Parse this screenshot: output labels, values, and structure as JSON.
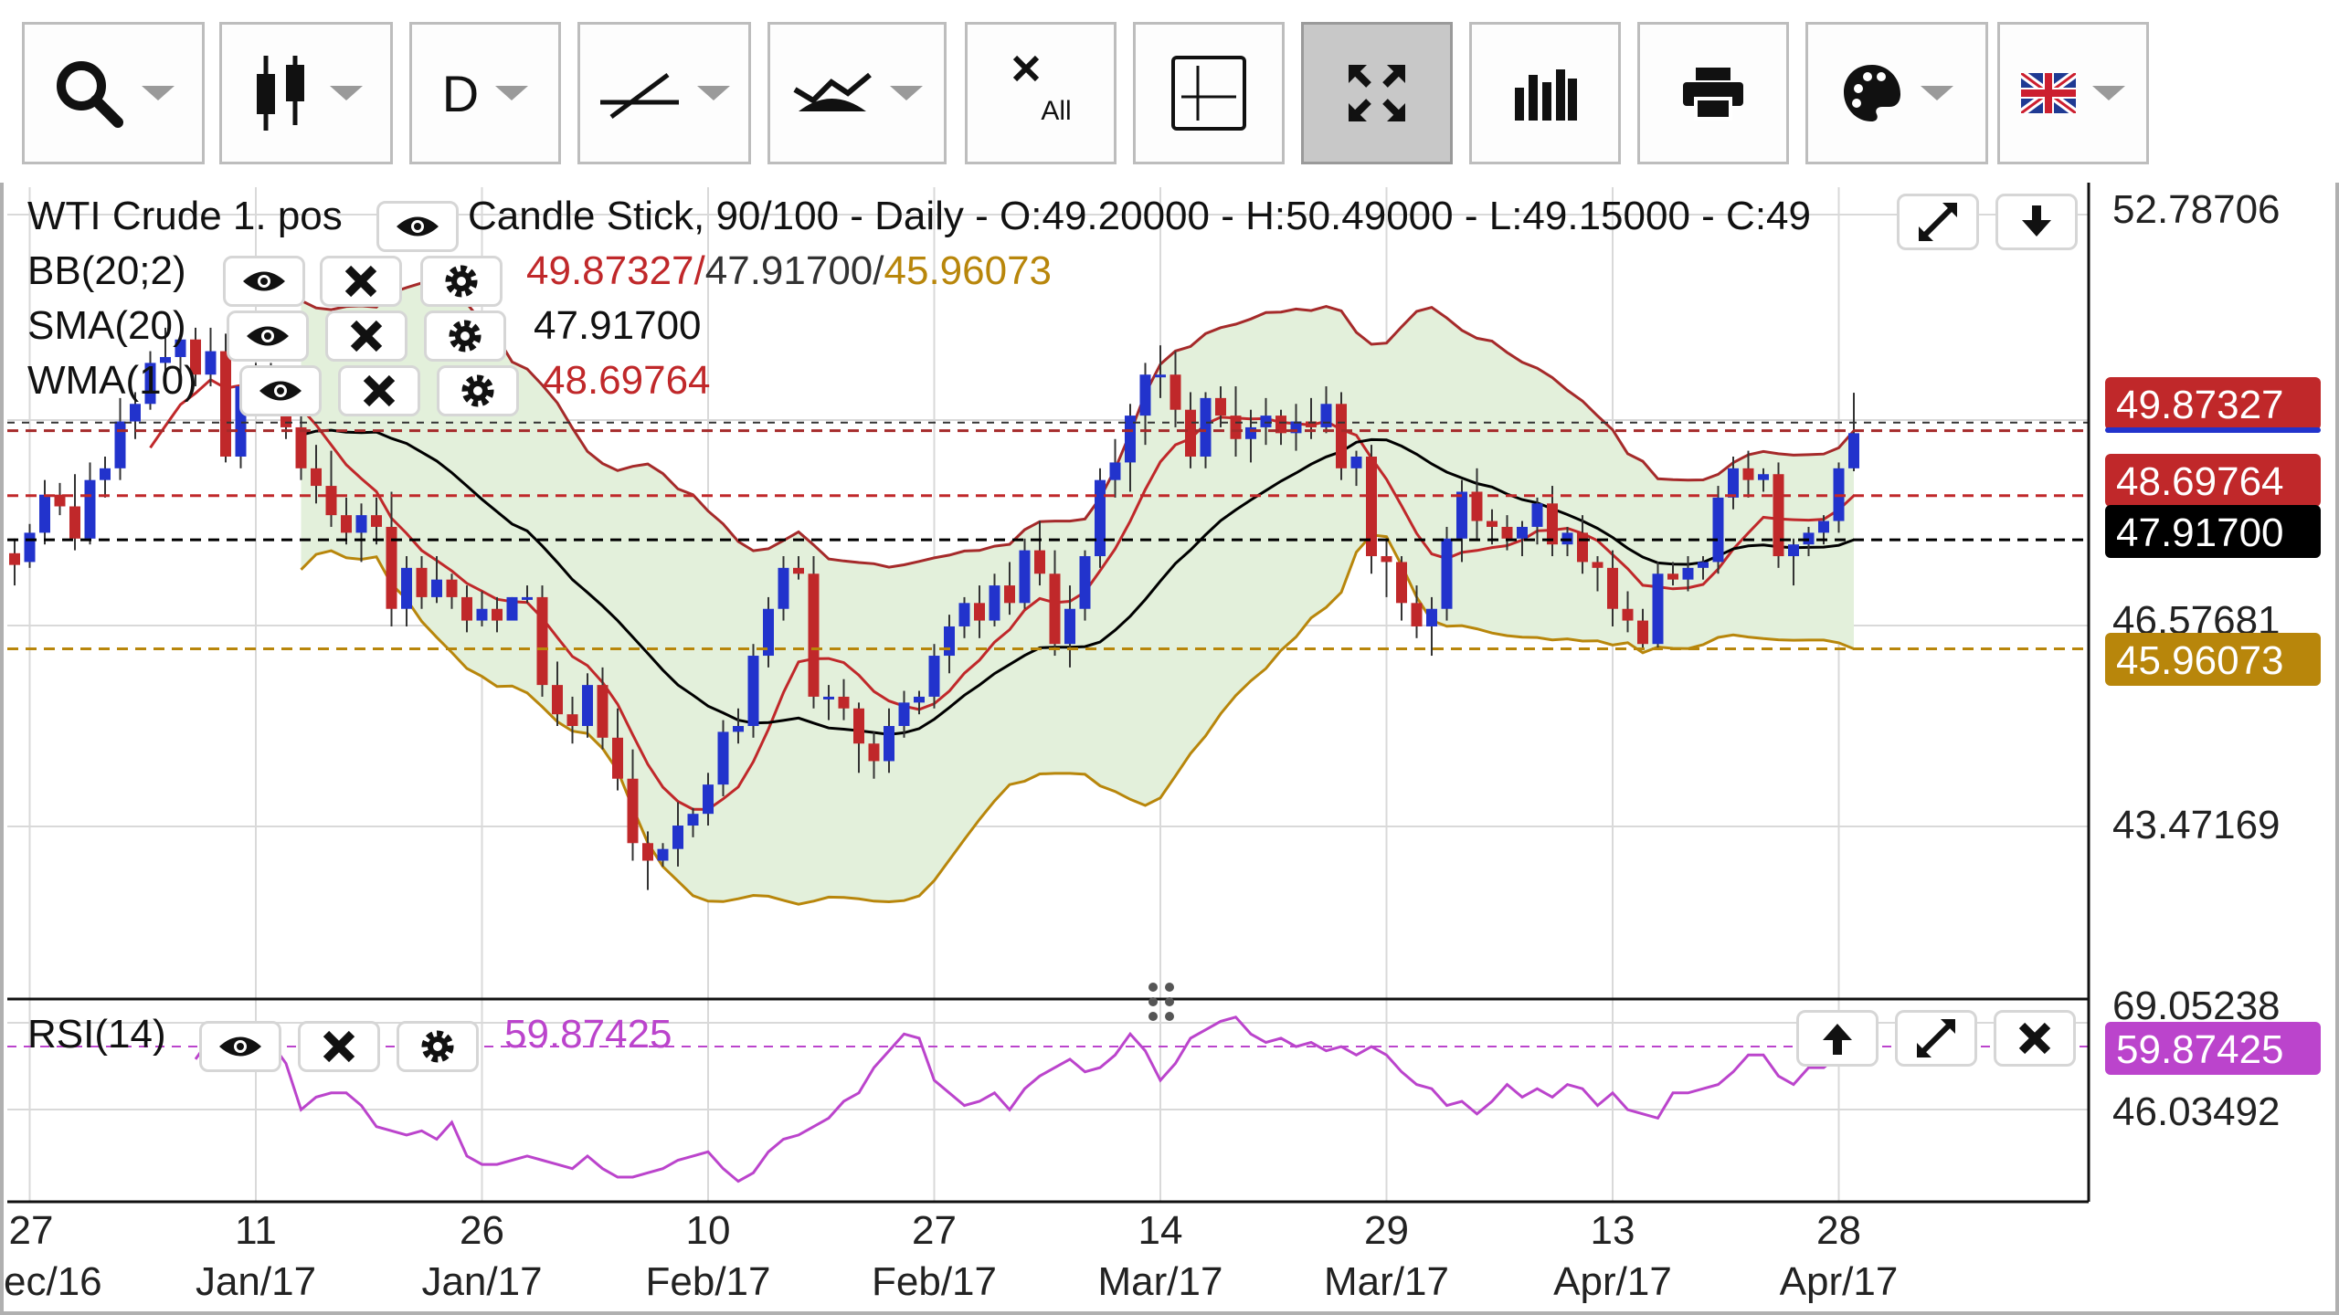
{
  "toolbar": {
    "period_label": "D",
    "clear_label": "All",
    "colors": {
      "border": "#bdbdbd",
      "active": "#c8c8c8"
    }
  },
  "header": {
    "instrument": "WTI Crude 1. pos",
    "description": "Candle Stick, 90/100 - Daily - O:49.20000 - H:50.49000 - L:49.15000 - C:49"
  },
  "indicators": {
    "bb": {
      "label": "BB(20;2)",
      "value_upper": "49.87327/",
      "value_mid": "47.91700/",
      "value_lower": "45.96073"
    },
    "sma": {
      "label": "SMA(20)",
      "value": "47.91700"
    },
    "wma": {
      "label": "WMA(10)",
      "value": "48.69764"
    },
    "rsi": {
      "label": "RSI(14)",
      "value": "59.87425"
    }
  },
  "price_axis": {
    "ticks": [
      "52.78706",
      "46.57681",
      "43.47169"
    ],
    "badges": {
      "upper": "49.87327",
      "wma": "48.69764",
      "sma": "47.91700",
      "lower": "45.96073"
    }
  },
  "rsi_axis": {
    "ticks": [
      "69.05238",
      "46.03492"
    ],
    "badge": "59.87425"
  },
  "x_axis": {
    "ticks": [
      {
        "day": "27",
        "month": "ec/16"
      },
      {
        "day": "11",
        "month": "Jan/17"
      },
      {
        "day": "26",
        "month": "Jan/17"
      },
      {
        "day": "10",
        "month": "Feb/17"
      },
      {
        "day": "27",
        "month": "Feb/17"
      },
      {
        "day": "14",
        "month": "Mar/17"
      },
      {
        "day": "29",
        "month": "Mar/17"
      },
      {
        "day": "13",
        "month": "Apr/17"
      },
      {
        "day": "28",
        "month": "Apr/17"
      }
    ]
  },
  "colors": {
    "bull": "#2233cc",
    "bear": "#c0282a",
    "bb_band": "#a52a2a",
    "bb_lower": "#b8860b",
    "sma": "#000000",
    "wma": "#c0282a",
    "rsi": "#bb44cc",
    "fill": "#e3f0db",
    "grid": "#d9d9d9"
  },
  "chart_data": {
    "type": "candlestick",
    "title": "WTI Crude 1. pos",
    "price_range": [
      40.2,
      54.0
    ],
    "rsi_range": [
      25,
      71
    ],
    "candles": [
      [
        47.75,
        48.0,
        47.2,
        47.55
      ],
      [
        47.6,
        48.25,
        47.5,
        48.1
      ],
      [
        48.1,
        49.0,
        47.9,
        48.75
      ],
      [
        48.75,
        48.95,
        48.4,
        48.55
      ],
      [
        48.55,
        49.1,
        47.8,
        48.0
      ],
      [
        48.0,
        49.3,
        47.9,
        49.0
      ],
      [
        49.0,
        49.4,
        48.7,
        49.2
      ],
      [
        49.2,
        50.4,
        49.0,
        50.0
      ],
      [
        50.0,
        50.5,
        49.7,
        50.3
      ],
      [
        50.3,
        51.2,
        50.2,
        51.0
      ],
      [
        51.0,
        51.6,
        50.7,
        51.1
      ],
      [
        51.1,
        51.5,
        50.8,
        51.4
      ],
      [
        51.4,
        51.6,
        50.6,
        50.8
      ],
      [
        50.8,
        51.6,
        50.6,
        51.2
      ],
      [
        51.2,
        51.5,
        49.3,
        49.4
      ],
      [
        49.4,
        50.8,
        49.2,
        50.6
      ],
      [
        50.6,
        51.0,
        50.3,
        50.6
      ],
      [
        50.6,
        51.0,
        50.4,
        50.7
      ],
      [
        50.7,
        50.9,
        49.7,
        49.9
      ],
      [
        49.9,
        50.4,
        49.0,
        49.2
      ],
      [
        49.2,
        49.6,
        48.6,
        48.9
      ],
      [
        48.9,
        49.5,
        48.2,
        48.4
      ],
      [
        48.4,
        48.7,
        47.9,
        48.1
      ],
      [
        48.1,
        48.6,
        47.6,
        48.4
      ],
      [
        48.4,
        48.7,
        47.9,
        48.2
      ],
      [
        48.2,
        48.8,
        46.5,
        46.8
      ],
      [
        46.8,
        47.7,
        46.5,
        47.5
      ],
      [
        47.5,
        47.7,
        46.8,
        47.0
      ],
      [
        47.0,
        47.7,
        46.9,
        47.3
      ],
      [
        47.3,
        47.4,
        46.8,
        47.0
      ],
      [
        47.0,
        47.2,
        46.4,
        46.6
      ],
      [
        46.6,
        47.1,
        46.5,
        46.8
      ],
      [
        46.8,
        47.0,
        46.4,
        46.6
      ],
      [
        46.6,
        47.0,
        46.8,
        47.0
      ],
      [
        47.0,
        47.2,
        46.9,
        47.0
      ],
      [
        47.0,
        47.2,
        45.3,
        45.5
      ],
      [
        45.5,
        45.9,
        44.8,
        45.0
      ],
      [
        45.0,
        45.3,
        44.5,
        44.8
      ],
      [
        44.8,
        45.7,
        44.6,
        45.5
      ],
      [
        45.5,
        45.8,
        44.4,
        44.6
      ],
      [
        44.6,
        45.1,
        43.7,
        43.9
      ],
      [
        43.9,
        44.4,
        42.5,
        42.8
      ],
      [
        42.8,
        43.0,
        42.0,
        42.5
      ],
      [
        42.5,
        42.8,
        42.4,
        42.7
      ],
      [
        42.7,
        43.5,
        42.4,
        43.1
      ],
      [
        43.1,
        43.4,
        42.9,
        43.3
      ],
      [
        43.3,
        44.0,
        43.1,
        43.8
      ],
      [
        43.8,
        44.9,
        43.6,
        44.7
      ],
      [
        44.7,
        45.1,
        44.5,
        44.8
      ],
      [
        44.8,
        46.2,
        44.6,
        46.0
      ],
      [
        46.0,
        47.0,
        45.8,
        46.8
      ],
      [
        46.8,
        47.7,
        46.6,
        47.5
      ],
      [
        47.5,
        47.7,
        47.3,
        47.4
      ],
      [
        47.4,
        47.7,
        45.1,
        45.3
      ],
      [
        45.3,
        45.5,
        44.9,
        45.3
      ],
      [
        45.3,
        45.6,
        44.9,
        45.1
      ],
      [
        45.1,
        45.2,
        44.0,
        44.5
      ],
      [
        44.5,
        44.7,
        43.9,
        44.2
      ],
      [
        44.2,
        45.1,
        44.0,
        44.8
      ],
      [
        44.8,
        45.4,
        44.6,
        45.2
      ],
      [
        45.2,
        45.4,
        45.0,
        45.3
      ],
      [
        45.3,
        46.2,
        45.1,
        46.0
      ],
      [
        46.0,
        46.7,
        45.7,
        46.5
      ],
      [
        46.5,
        47.0,
        46.3,
        46.9
      ],
      [
        46.9,
        47.2,
        46.3,
        46.6
      ],
      [
        46.6,
        47.4,
        46.5,
        47.2
      ],
      [
        47.2,
        47.6,
        46.7,
        46.9
      ],
      [
        46.9,
        48.0,
        46.8,
        47.8
      ],
      [
        47.8,
        48.3,
        47.2,
        47.4
      ],
      [
        47.4,
        47.8,
        46.0,
        46.2
      ],
      [
        46.2,
        47.2,
        45.8,
        46.8
      ],
      [
        46.8,
        47.8,
        46.6,
        47.7
      ],
      [
        47.7,
        49.2,
        47.5,
        49.0
      ],
      [
        49.0,
        49.7,
        48.7,
        49.3
      ],
      [
        49.3,
        50.3,
        48.8,
        50.1
      ],
      [
        50.1,
        51.0,
        49.6,
        50.8
      ],
      [
        50.8,
        51.3,
        50.4,
        50.8
      ],
      [
        50.8,
        51.2,
        49.9,
        50.2
      ],
      [
        50.2,
        50.5,
        49.2,
        49.4
      ],
      [
        49.4,
        50.5,
        49.2,
        50.4
      ],
      [
        50.4,
        50.6,
        49.9,
        50.1
      ],
      [
        50.1,
        50.6,
        49.4,
        49.7
      ],
      [
        49.7,
        50.2,
        49.3,
        49.9
      ],
      [
        49.9,
        50.4,
        49.6,
        50.1
      ],
      [
        50.1,
        50.2,
        49.6,
        49.8
      ],
      [
        49.8,
        50.3,
        49.5,
        50.0
      ],
      [
        50.0,
        50.4,
        49.7,
        49.9
      ],
      [
        49.9,
        50.6,
        49.8,
        50.3
      ],
      [
        50.3,
        50.5,
        49.0,
        49.2
      ],
      [
        49.2,
        49.5,
        48.9,
        49.4
      ],
      [
        49.4,
        49.6,
        47.4,
        47.7
      ],
      [
        47.7,
        48.0,
        47.0,
        47.6
      ],
      [
        47.6,
        47.7,
        46.6,
        46.9
      ],
      [
        46.9,
        47.2,
        46.3,
        46.5
      ],
      [
        46.5,
        47.0,
        46.0,
        46.8
      ],
      [
        46.8,
        48.2,
        46.6,
        48.0
      ],
      [
        48.0,
        49.0,
        47.6,
        48.8
      ],
      [
        48.8,
        49.2,
        48.0,
        48.3
      ],
      [
        48.3,
        48.5,
        47.9,
        48.2
      ],
      [
        48.2,
        48.4,
        47.8,
        48.0
      ],
      [
        48.0,
        48.3,
        47.7,
        48.2
      ],
      [
        48.2,
        48.7,
        47.9,
        48.6
      ],
      [
        48.6,
        48.9,
        47.7,
        47.9
      ],
      [
        47.9,
        48.2,
        47.7,
        48.1
      ],
      [
        48.1,
        48.4,
        47.4,
        47.6
      ],
      [
        47.6,
        47.7,
        47.1,
        47.5
      ],
      [
        47.5,
        47.8,
        46.5,
        46.8
      ],
      [
        46.8,
        47.1,
        46.4,
        46.6
      ],
      [
        46.6,
        46.8,
        46.1,
        46.2
      ],
      [
        46.2,
        47.6,
        46.1,
        47.4
      ],
      [
        47.4,
        47.6,
        47.2,
        47.3
      ],
      [
        47.3,
        47.7,
        47.1,
        47.5
      ],
      [
        47.5,
        47.7,
        47.3,
        47.6
      ],
      [
        47.6,
        48.9,
        47.4,
        48.7
      ],
      [
        48.7,
        49.4,
        48.5,
        49.2
      ],
      [
        49.2,
        49.5,
        48.7,
        49.0
      ],
      [
        49.0,
        49.2,
        48.8,
        49.1
      ],
      [
        49.1,
        49.3,
        47.5,
        47.7
      ],
      [
        47.7,
        48.0,
        47.2,
        47.9
      ],
      [
        47.9,
        48.2,
        47.7,
        48.1
      ],
      [
        48.1,
        48.4,
        47.9,
        48.3
      ],
      [
        48.3,
        49.3,
        48.1,
        49.2
      ],
      [
        49.2,
        50.49,
        49.15,
        49.8
      ]
    ],
    "rsi_start": 12,
    "rsi": [
      58.0,
      63.0,
      66.0,
      63.0,
      64.0,
      62.0,
      57.0,
      46.0,
      49.0,
      50.0,
      50.0,
      47.0,
      42.0,
      41.0,
      40.0,
      41.0,
      39.0,
      43.0,
      35.0,
      33.0,
      33.0,
      34.0,
      35.0,
      34.0,
      33.0,
      32.0,
      35.0,
      32.0,
      30.0,
      30.0,
      31.0,
      32.0,
      34.0,
      35.0,
      36.0,
      32.0,
      29.0,
      31.0,
      36.0,
      39.0,
      40.0,
      42.0,
      44.0,
      48.0,
      50.0,
      56.0,
      60.0,
      64.0,
      63.0,
      53.0,
      50.0,
      47.0,
      48.0,
      50.0,
      46.0,
      51.0,
      54.0,
      56.0,
      58.0,
      55.0,
      56.0,
      59.0,
      64.0,
      60.0,
      53.0,
      57.0,
      63.0,
      65.0,
      67.0,
      68.0,
      64.0,
      62.0,
      63.0,
      61.0,
      62.0,
      60.0,
      61.0,
      59.0,
      61.0,
      59.0,
      55.0,
      52.0,
      51.0,
      47.0,
      48.0,
      45.0,
      48.0,
      52.0,
      49.0,
      51.0,
      49.0,
      52.0,
      51.0,
      47.0,
      50.0,
      46.0,
      45.0,
      44.0,
      50.0,
      50.0,
      51.0,
      52.0,
      55.0,
      59.0,
      59.0,
      54.0,
      52.0,
      56.0,
      56.0,
      59.0,
      60.0
    ]
  }
}
